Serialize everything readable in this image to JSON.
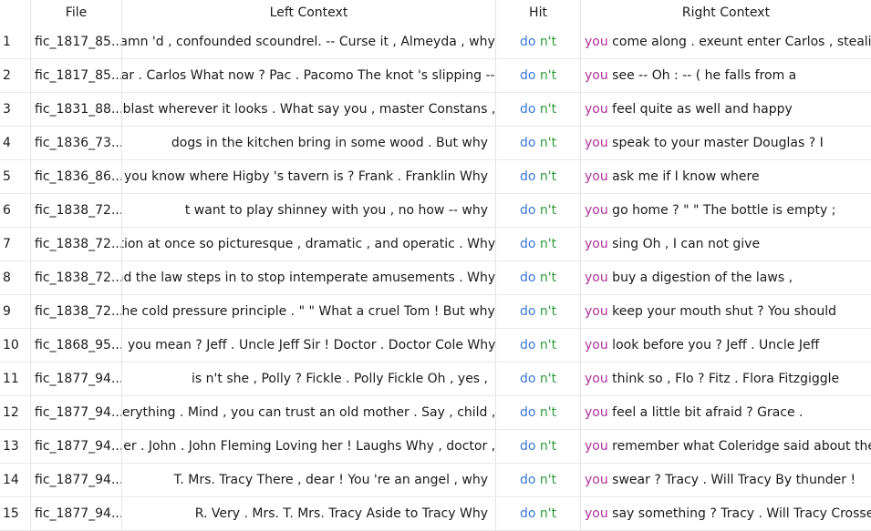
{
  "columns": {
    "file": "File",
    "left": "Left Context",
    "hit": "Hit",
    "right": "Right Context"
  },
  "colors": {
    "hit_do": "#3a78d6",
    "hit_nt": "#2e9a3c",
    "right_keyword": "#b0329a"
  },
  "rows": [
    {
      "n": "1",
      "file": "fic_1817_85...",
      "left": "- damn 'd , confounded scoundrel. -- Curse it , Almeyda , why",
      "hit_do": "do",
      "hit_nt": "n't",
      "kw": "you",
      "right": " come along . exeunt enter Carlos , stealing"
    },
    {
      "n": "2",
      "file": "fic_1817_85...",
      "left": "Car . Carlos What now ? Pac . Pacomo The knot 's slipping --",
      "hit_do": "do",
      "hit_nt": "n't",
      "kw": "you",
      "right": " see -- Oh : -- ( he falls from a"
    },
    {
      "n": "3",
      "file": "fic_1831_88...",
      "left": "can blast wherever it looks . What say you , master Constans ,",
      "hit_do": "do",
      "hit_nt": "n't",
      "kw": "you",
      "right": " feel quite as well and happy"
    },
    {
      "n": "4",
      "file": "fic_1836_73...",
      "left": "dogs in the kitchen bring in some wood . But why",
      "hit_do": "do",
      "hit_nt": "n't",
      "kw": "you",
      "right": " speak to your master Douglas ? I"
    },
    {
      "n": "5",
      "file": "fic_1836_86...",
      "left": "you know where Higby 's tavern is ? Frank . Franklin Why",
      "hit_do": "do",
      "hit_nt": "n't",
      "kw": "you",
      "right": " ask me if I know where"
    },
    {
      "n": "6",
      "file": "fic_1838_72...",
      "left": "t want to play shinney with you , no how -- why",
      "hit_do": "do",
      "hit_nt": "n't",
      "kw": "you",
      "right": " go home ? \" \" The bottle is empty ;"
    },
    {
      "n": "7",
      "file": "fic_1838_72...",
      "left": "uation at once so picturesque , dramatic , and operatic . Why",
      "hit_do": "do",
      "hit_nt": "n't",
      "kw": "you",
      "right": " sing Oh , I can not give"
    },
    {
      "n": "8",
      "file": "fic_1838_72...",
      "left": "and the law steps in to stop intemperate amusements . Why",
      "hit_do": "do",
      "hit_nt": "n't",
      "kw": "you",
      "right": " buy a digestion of the laws ,"
    },
    {
      "n": "9",
      "file": "fic_1838_72...",
      "left": "the cold pressure principle . \" \" What a cruel Tom ! But why",
      "hit_do": "do",
      "hit_nt": "n't",
      "kw": "you",
      "right": " keep your mouth shut ? You should"
    },
    {
      "n": "10",
      "file": "fic_1868_95...",
      "left": "you mean ? Jeff . Uncle Jeff Sir ! Doctor . Doctor Cole Why",
      "hit_do": "do",
      "hit_nt": "n't",
      "kw": "you",
      "right": " look before you ? Jeff . Uncle Jeff"
    },
    {
      "n": "11",
      "file": "fic_1877_94...",
      "left": "is n't she , Polly ? Fickle . Polly Fickle Oh , yes ,",
      "hit_do": "do",
      "hit_nt": "n't",
      "kw": "you",
      "right": " think so , Flo ? Fitz . Flora Fitzgiggle"
    },
    {
      "n": "12",
      "file": "fic_1877_94...",
      "left": "everything . Mind , you can trust an old mother . Say , child ,",
      "hit_do": "do",
      "hit_nt": "n't",
      "kw": "you",
      "right": " feel a little bit afraid ? Grace ."
    },
    {
      "n": "13",
      "file": "fic_1877_94...",
      "left": "g her . John . John Fleming Loving her ! Laughs Why , doctor ,",
      "hit_do": "do",
      "hit_nt": "n't",
      "kw": "you",
      "right": " remember what Coleridge said about the"
    },
    {
      "n": "14",
      "file": "fic_1877_94...",
      "left": "T. Mrs. Tracy There , dear ! You 're an angel , why",
      "hit_do": "do",
      "hit_nt": "n't",
      "kw": "you",
      "right": " swear ? Tracy . Will Tracy By thunder !"
    },
    {
      "n": "15",
      "file": "fic_1877_94...",
      "left": "R. Very . Mrs. T. Mrs. Tracy Aside to Tracy Why",
      "hit_do": "do",
      "hit_nt": "n't",
      "kw": "you",
      "right": " say something ? Tracy . Will Tracy Crosses"
    }
  ]
}
